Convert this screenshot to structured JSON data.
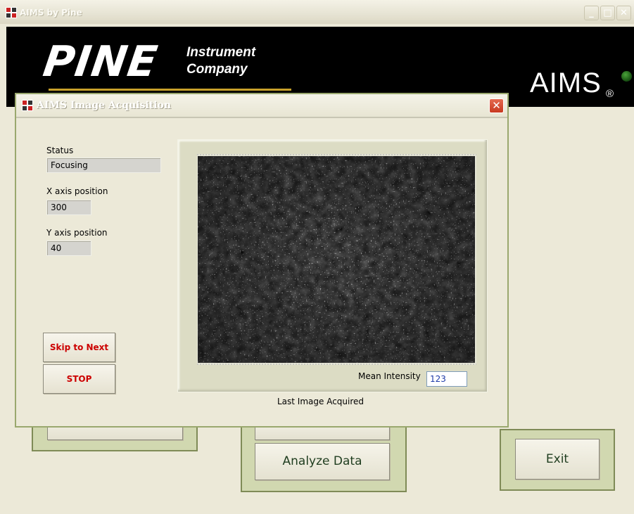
{
  "main_window": {
    "title": "AIMS by Pine",
    "brand_logo": "PINE",
    "brand_line1": "Instrument",
    "brand_line2": "Company",
    "product_logo": "AIMS",
    "registered_mark": "®",
    "controls": {
      "minimize_glyph": "_",
      "maximize_glyph": "□",
      "close_glyph": "✕"
    },
    "buttons": {
      "analyze_data": "Analyze Data",
      "exit": "Exit"
    }
  },
  "dialog": {
    "title": "AIMS Image Acquisition",
    "close_glyph": "✕",
    "status_label": "Status",
    "status_value": "Focusing",
    "x_axis_label": "X axis position",
    "x_axis_value": "300",
    "y_axis_label": "Y axis position",
    "y_axis_value": "40",
    "skip_button": "Skip to Next",
    "stop_button": "STOP",
    "mean_intensity_label": "Mean Intensity",
    "mean_intensity_value": "123",
    "image_caption": "Last Image Acquired"
  },
  "icons": {
    "app": "app-icon",
    "dialog": "app-icon",
    "status_led": "status-led-icon"
  },
  "colors": {
    "window_face": "#ece9d8",
    "banner": "#000000",
    "accent_gold": "#c8a12a",
    "panel_green": "#d1d8b0",
    "button_red_text": "#cc0000",
    "button_green_text": "#1f3d1f",
    "led_green": "#2f7d24"
  }
}
